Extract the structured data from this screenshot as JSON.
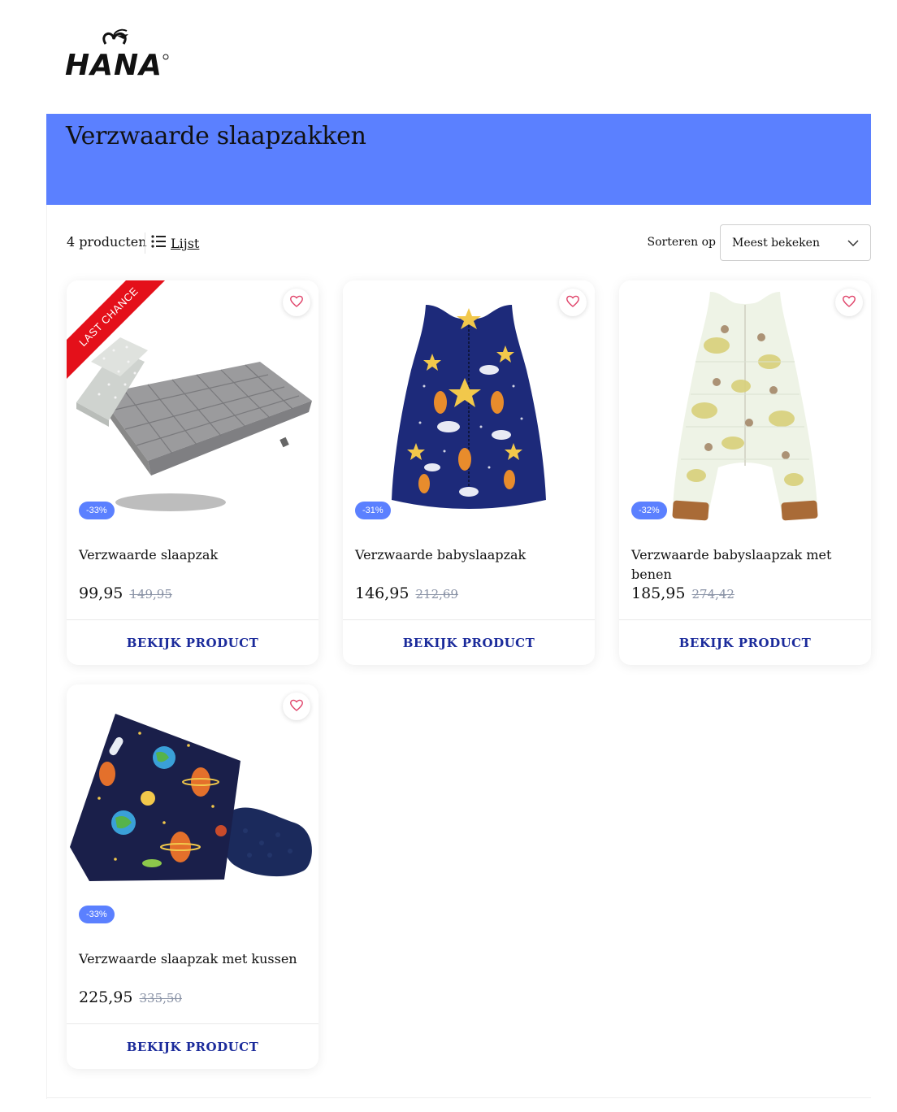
{
  "brand": {
    "logo_text": "HANA"
  },
  "hero": {
    "title": "Verzwaarde slaapzakken",
    "color": "#5b80ff"
  },
  "toolbar": {
    "count": "4 producten",
    "view_label": "Lijst",
    "view_icon": "list-icon",
    "sort_label": "Sorteren op",
    "sort_value": "Meest bekeken",
    "sort_icon": "chevron-down-icon"
  },
  "products": [
    {
      "name": "Verzwaarde slaapzak",
      "price": "99,95",
      "old_price": "149,95",
      "discount": "-33%",
      "ribbon": "LAST CHANCE",
      "cta": "BEKIJK PRODUCT",
      "image": "grey weighted blanket with pillows",
      "wish_icon": "heart-icon"
    },
    {
      "name": "Verzwaarde babyslaapzak",
      "price": "146,95",
      "old_price": "212,69",
      "discount": "-31%",
      "cta": "BEKIJK PRODUCT",
      "image": "navy baby sleeping bag with stars",
      "wish_icon": "heart-icon"
    },
    {
      "name": "Verzwaarde babyslaapzak met benen",
      "price": "185,95",
      "old_price": "274,42",
      "discount": "-32%",
      "cta": "BEKIJK PRODUCT",
      "image": "floral sleeping bag with legs",
      "wish_icon": "heart-icon"
    },
    {
      "name": "Verzwaarde slaapzak met kussen",
      "price": "225,95",
      "old_price": "335,50",
      "discount": "-33%",
      "cta": "BEKIJK PRODUCT",
      "image": "space print pillow with navy blanket",
      "wish_icon": "heart-icon"
    }
  ],
  "colors": {
    "accent": "#5b80ff",
    "cta": "#1b2b9b",
    "ribbon": "#e4101a",
    "heart": "#e0456b",
    "old_price": "#8a93a6"
  }
}
